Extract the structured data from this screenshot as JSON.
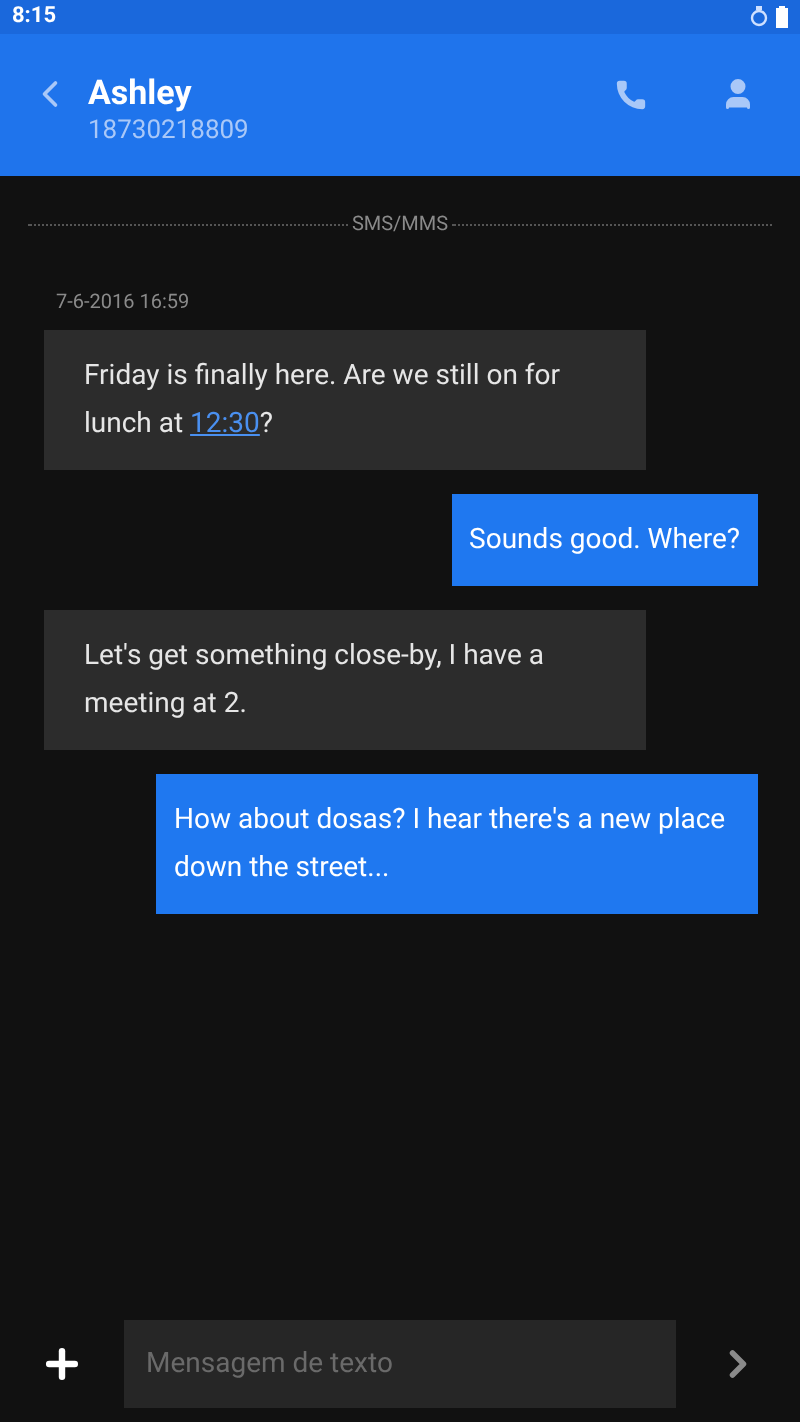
{
  "status_bar": {
    "time": "8:15"
  },
  "header": {
    "name": "Ashley",
    "number": "18730218809"
  },
  "divider_label": "SMS/MMS",
  "timestamp": "7-6-2016 16:59",
  "messages": [
    {
      "kind": "incoming",
      "parts": [
        {
          "kind": "plain",
          "text": "Friday is finally here. Are we still on for lunch at "
        },
        {
          "kind": "link",
          "text": "12:30"
        },
        {
          "kind": "plain",
          "text": "?"
        }
      ]
    },
    {
      "kind": "outgoing",
      "parts": [
        {
          "kind": "plain",
          "text": "Sounds good. Where?"
        }
      ]
    },
    {
      "kind": "incoming",
      "parts": [
        {
          "kind": "plain",
          "text": "Let's get something close-by, I have a meeting at 2."
        }
      ]
    },
    {
      "kind": "outgoing",
      "parts": [
        {
          "kind": "plain",
          "text": "How about dosas? I hear there's a new place down the street..."
        }
      ]
    }
  ],
  "composer": {
    "placeholder": "Mensagem de texto"
  }
}
